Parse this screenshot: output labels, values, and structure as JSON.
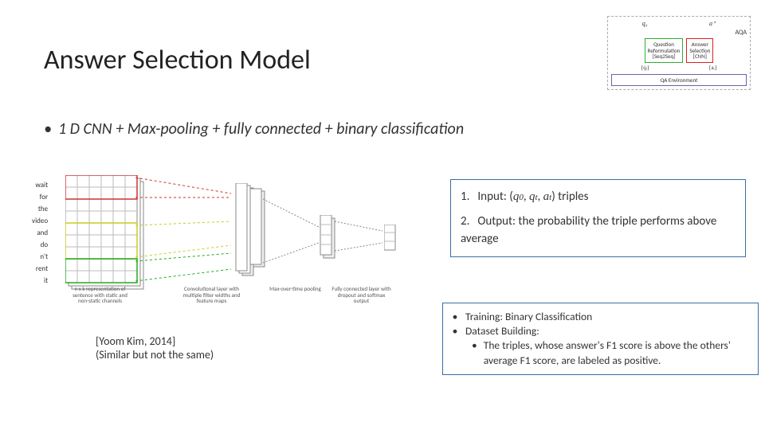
{
  "title": "Answer Selection Model",
  "aqa": {
    "top_left": "q₀",
    "top_right": "a⁺",
    "label": "AQA",
    "box_qr_line1": "Question",
    "box_qr_line2": "Reformulation",
    "box_qr_line3": "[Seq2Seq]",
    "box_as_line1": "Answer",
    "box_as_line2": "Selection",
    "box_as_line3": "[CNN]",
    "bot_left": "{qᵢ}",
    "bot_right": "{aᵢ}",
    "env": "QA Environment"
  },
  "main_bullet": "1 D CNN + Max-pooling + fully connected + binary classification",
  "figure": {
    "words": [
      "wait",
      "for",
      "the",
      "video",
      "and",
      "do",
      "n't",
      "rent",
      "it"
    ],
    "caption1": "n x k representation of sentence with static and non-static channels",
    "caption2": "Convolutional layer with multiple filter widths and feature maps",
    "caption3": "Max-over-time pooling",
    "caption4": "Fully connected layer with dropout and softmax output"
  },
  "io": {
    "line1_prefix": "Input: (",
    "line1_q0": "q",
    "line1_q0_sub": "0",
    "line1_sep1": ", ",
    "line1_qt": "q",
    "line1_qt_sub": "t",
    "line1_sep2": ", ",
    "line1_at": "a",
    "line1_at_sub": "t",
    "line1_suffix": ") triples",
    "line2": "Output: the probability the triple performs above average"
  },
  "training": {
    "item1": "Training: Binary Classification",
    "item2": "Dataset Building:",
    "sub": "The triples, whose answer's F1 score is above the others' average F1 score, are labeled as positive."
  },
  "citation": {
    "line1": "[Yoom Kim, 2014]",
    "line2": "(Similar but not the same)"
  }
}
